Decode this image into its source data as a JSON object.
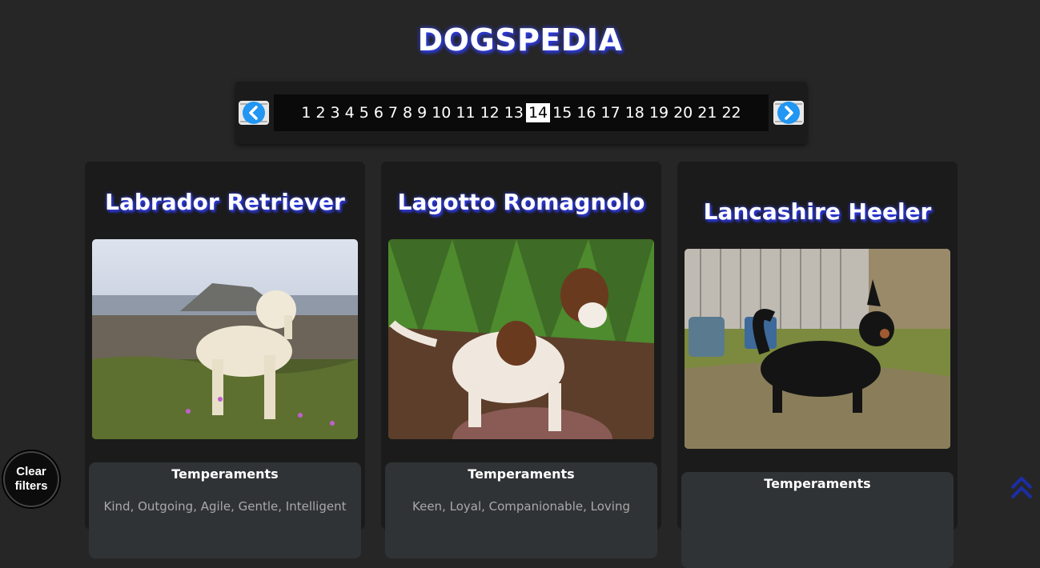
{
  "header": {
    "title": "DOGSPEDIA"
  },
  "pagination": {
    "pages": [
      "1",
      "2",
      "3",
      "4",
      "5",
      "6",
      "7",
      "8",
      "9",
      "10",
      "11",
      "12",
      "13",
      "14",
      "15",
      "16",
      "17",
      "18",
      "19",
      "20",
      "21",
      "22"
    ],
    "current": "14",
    "prev_icon": "chevron-left-icon",
    "next_icon": "chevron-right-icon"
  },
  "cards": [
    {
      "name": "Labrador Retriever",
      "temperaments_label": "Temperaments",
      "temperaments": "Kind, Outgoing, Agile, Gentle, Intelligent"
    },
    {
      "name": "Lagotto Romagnolo",
      "temperaments_label": "Temperaments",
      "temperaments": "Keen, Loyal, Companionable, Loving"
    },
    {
      "name": "Lancashire Heeler",
      "temperaments_label": "Temperaments",
      "temperaments": ""
    }
  ],
  "controls": {
    "clear_filters": "Clear filters",
    "scroll_top_icon": "double-chevron-up-icon"
  },
  "colors": {
    "background": "#262626",
    "card": "#1b1b1b",
    "accent_glow": "#2d39e0",
    "arrow_blue": "#2196f3"
  }
}
